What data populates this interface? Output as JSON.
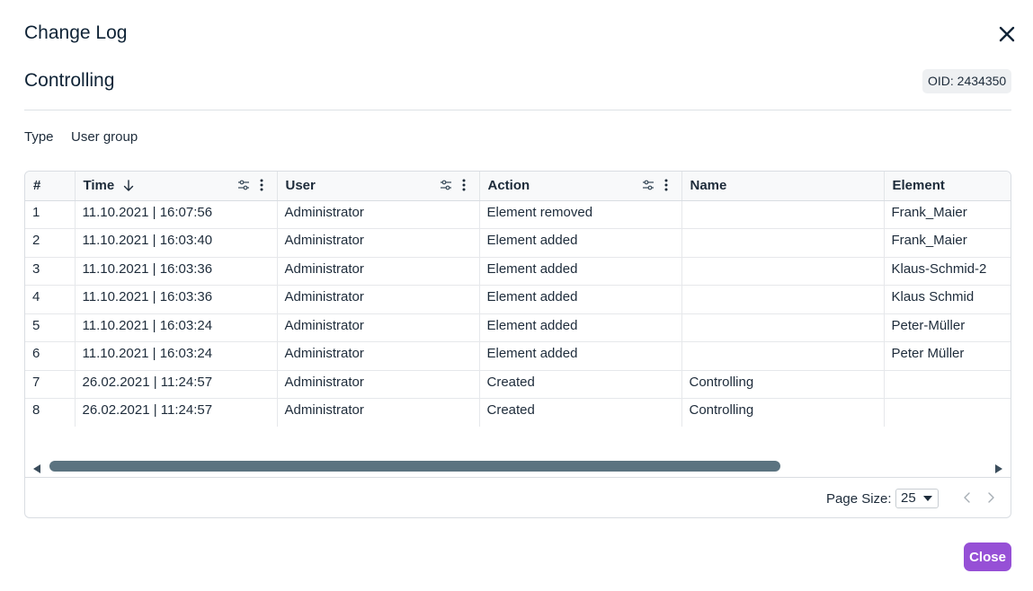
{
  "dialog": {
    "title": "Change Log",
    "subtitle": "Controlling",
    "oid": "OID: 2434350",
    "type_label": "Type",
    "type_value": "User group",
    "close_label": "Close"
  },
  "grid": {
    "columns": [
      "#",
      "Time",
      "User",
      "Action",
      "Name",
      "Element"
    ],
    "rows": [
      [
        "1",
        "11.10.2021 | 16:07:56",
        "Administrator",
        "Element removed",
        "",
        "Frank_Maier"
      ],
      [
        "2",
        "11.10.2021 | 16:03:40",
        "Administrator",
        "Element added",
        "",
        "Frank_Maier"
      ],
      [
        "3",
        "11.10.2021 | 16:03:36",
        "Administrator",
        "Element added",
        "",
        "Klaus-Schmid-2"
      ],
      [
        "4",
        "11.10.2021 | 16:03:36",
        "Administrator",
        "Element added",
        "",
        "Klaus Schmid"
      ],
      [
        "5",
        "11.10.2021 | 16:03:24",
        "Administrator",
        "Element added",
        "",
        "Peter-Müller"
      ],
      [
        "6",
        "11.10.2021 | 16:03:24",
        "Administrator",
        "Element added",
        "",
        "Peter Müller"
      ],
      [
        "7",
        "26.02.2021 | 11:24:57",
        "Administrator",
        "Created",
        "Controlling",
        ""
      ],
      [
        "8",
        "26.02.2021 | 11:24:57",
        "Administrator",
        "Created",
        "Controlling",
        ""
      ]
    ]
  },
  "footer": {
    "page_size_label": "Page Size:",
    "page_size_value": "25"
  },
  "icons": {
    "close": "close-icon",
    "sort": "arrow-down-icon",
    "filter": "sliders-icon",
    "menu": "kebab-menu-icon",
    "scroll_left": "triangle-left-icon",
    "scroll_right": "triangle-right-icon",
    "prev": "chevron-left-icon",
    "next": "chevron-right-icon"
  },
  "colors": {
    "accent": "#9650d6",
    "scroll_thumb": "#5b7380",
    "text": "#1d2b3a"
  }
}
